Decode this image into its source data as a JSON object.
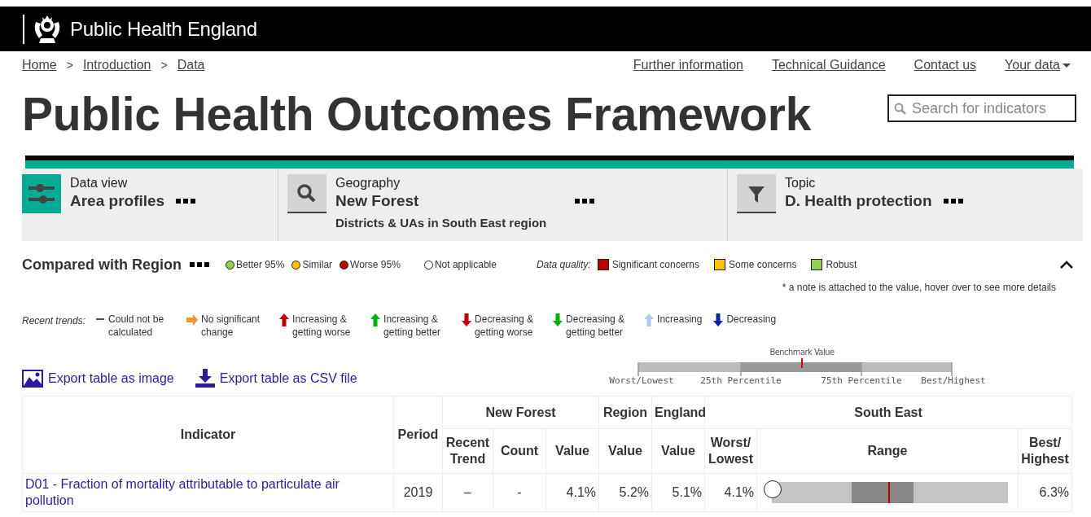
{
  "header": {
    "org_name": "Public Health England"
  },
  "breadcrumbs": {
    "items": [
      "Home",
      "Introduction",
      "Data"
    ],
    "separators": [
      ">",
      ">"
    ]
  },
  "top_links": [
    {
      "label": "Further information",
      "dropdown": false
    },
    {
      "label": "Technical Guidance",
      "dropdown": false
    },
    {
      "label": "Contact us",
      "dropdown": false
    },
    {
      "label": "Your data",
      "dropdown": true
    }
  ],
  "title": "Public Health Outcomes Framework",
  "search": {
    "placeholder": "Search for indicators"
  },
  "selectors": [
    {
      "kind": "data_view",
      "label": "Data view",
      "value": "Area profiles"
    },
    {
      "kind": "geography",
      "label": "Geography",
      "value": "New Forest",
      "subtitle": "Districts & UAs in South East region"
    },
    {
      "kind": "topic",
      "label": "Topic",
      "value": "D. Health protection"
    }
  ],
  "comparison_legend": {
    "title": "Compared with Region",
    "expanded": true,
    "items": [
      {
        "label": "Better 95%",
        "color": "#92d050"
      },
      {
        "label": "Similar",
        "color": "#ffc000"
      },
      {
        "label": "Worse 95%",
        "color": "#c00000"
      },
      {
        "label": "Not applicable",
        "color": "#ffffff"
      }
    ]
  },
  "data_quality": {
    "label": "Data quality:",
    "items": [
      {
        "label": "Significant concerns",
        "color": "#c00000"
      },
      {
        "label": "Some concerns",
        "color": "#ffc000"
      },
      {
        "label": "Robust",
        "color": "#92d050"
      }
    ]
  },
  "note": {
    "mark": "*",
    "text": "a note is attached to the value, hover over to see more details"
  },
  "trends": {
    "label": "Recent trends:",
    "items": [
      {
        "kind": "dash",
        "label": "Could not be calculated",
        "color": "#555555"
      },
      {
        "kind": "right",
        "label": "No significant change",
        "color": "#f0952b"
      },
      {
        "kind": "up",
        "label": "Increasing & getting worse",
        "color": "#c00000"
      },
      {
        "kind": "up",
        "label": "Increasing & getting better",
        "color": "#00b200"
      },
      {
        "kind": "down",
        "label": "Decreasing & getting worse",
        "color": "#c00000"
      },
      {
        "kind": "down",
        "label": "Decreasing & getting better",
        "color": "#00b200"
      },
      {
        "kind": "up",
        "label": "Increasing",
        "color": "#aec9f5"
      },
      {
        "kind": "down",
        "label": "Decreasing",
        "color": "#0a24a6"
      }
    ]
  },
  "export_links": [
    {
      "kind": "image",
      "label": "Export table as image"
    },
    {
      "kind": "csv",
      "label": "Export table as CSV file"
    }
  ],
  "benchmark_key": {
    "title": "Benchmark Value",
    "labels": [
      "Worst/Lowest",
      "25th Percentile",
      "75th Percentile",
      "Best/Highest"
    ]
  },
  "table": {
    "group_headers": [
      "Indicator",
      "Period",
      "New Forest",
      "Region",
      "England",
      "South East"
    ],
    "sub_headers": [
      "Recent Trend",
      "Count",
      "Value",
      "Value",
      "Value",
      "Worst/ Lowest",
      "Range",
      "Best/ Highest"
    ],
    "rows": [
      {
        "indicator": "D01 - Fraction of mortality attributable to particulate air pollution",
        "period": "2019",
        "recent_trend": "–",
        "count": "-",
        "value": "4.1%",
        "region_value": "5.2%",
        "england_value": "5.1%",
        "worst": "4.1%",
        "best": "6.3%",
        "color": "#ffffff"
      }
    ]
  }
}
